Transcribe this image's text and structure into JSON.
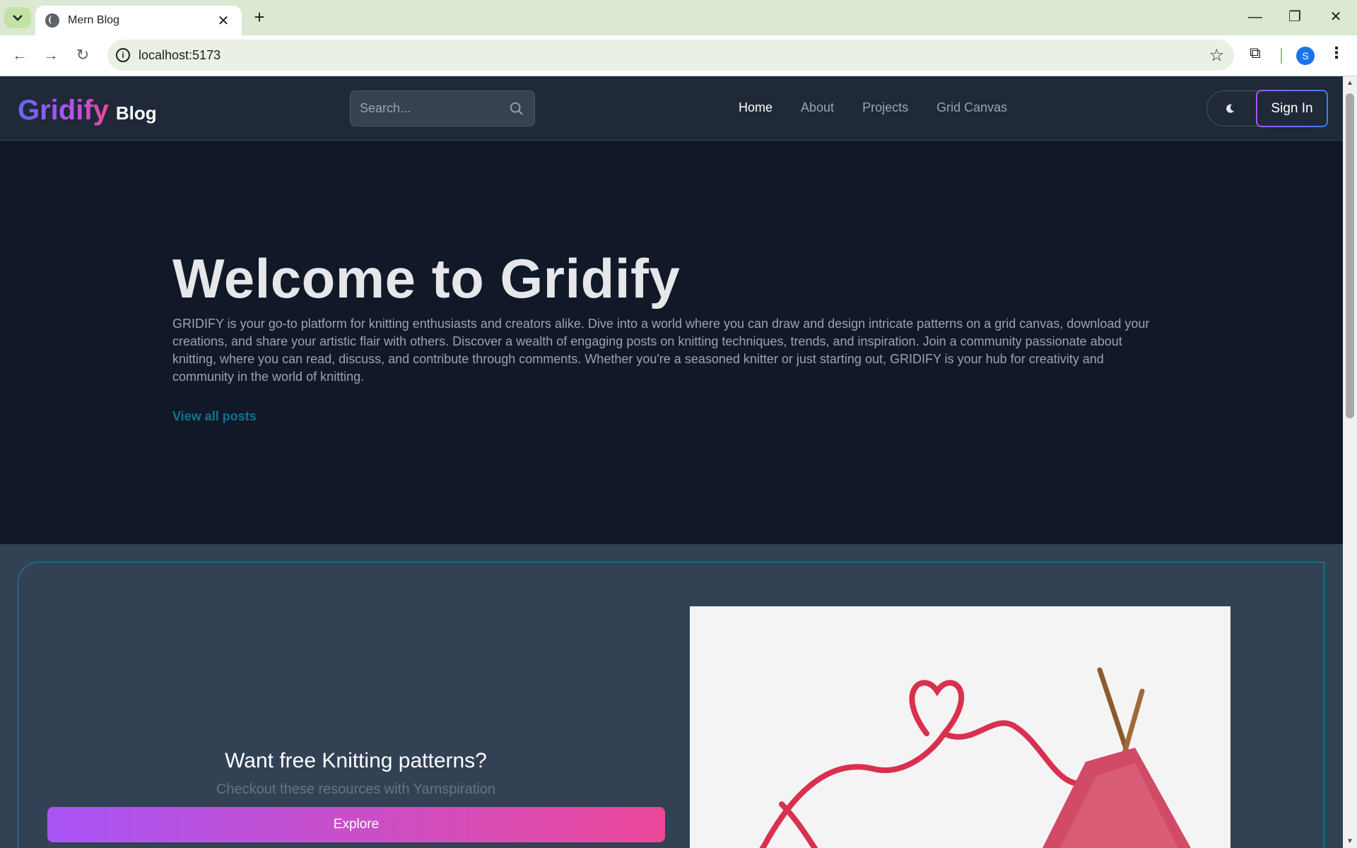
{
  "browser": {
    "tab_title": "Mern Blog",
    "url": "localhost:5173",
    "profile_initial": "S"
  },
  "site": {
    "logo_main": "Gridify",
    "logo_sub": "Blog",
    "search_placeholder": "Search...",
    "nav": [
      {
        "label": "Home",
        "active": true
      },
      {
        "label": "About",
        "active": false
      },
      {
        "label": "Projects",
        "active": false
      },
      {
        "label": "Grid Canvas",
        "active": false
      }
    ],
    "signin_label": "Sign In"
  },
  "hero": {
    "title": "Welcome to Gridify",
    "description": "GRIDIFY is your go-to platform for knitting enthusiasts and creators alike. Dive into a world where you can draw and design intricate patterns on a grid canvas, download your creations, and share your artistic flair with others. Discover a wealth of engaging posts on knitting techniques, trends, and inspiration. Join a community passionate about knitting, where you can read, discuss, and contribute through comments. Whether you're a seasoned knitter or just starting out, GRIDIFY is your hub for creativity and community in the world of knitting.",
    "view_all": "View all posts"
  },
  "cta": {
    "title": "Want free Knitting patterns?",
    "subtitle": "Checkout these resources with Yarnspiration",
    "button": "Explore"
  },
  "colors": {
    "page_bg": "#111827",
    "header_bg": "#1f2937",
    "cta_bg": "#334155",
    "accent_link": "#0e7490",
    "gradient_start": "#a855f7",
    "gradient_end": "#ec4899"
  }
}
